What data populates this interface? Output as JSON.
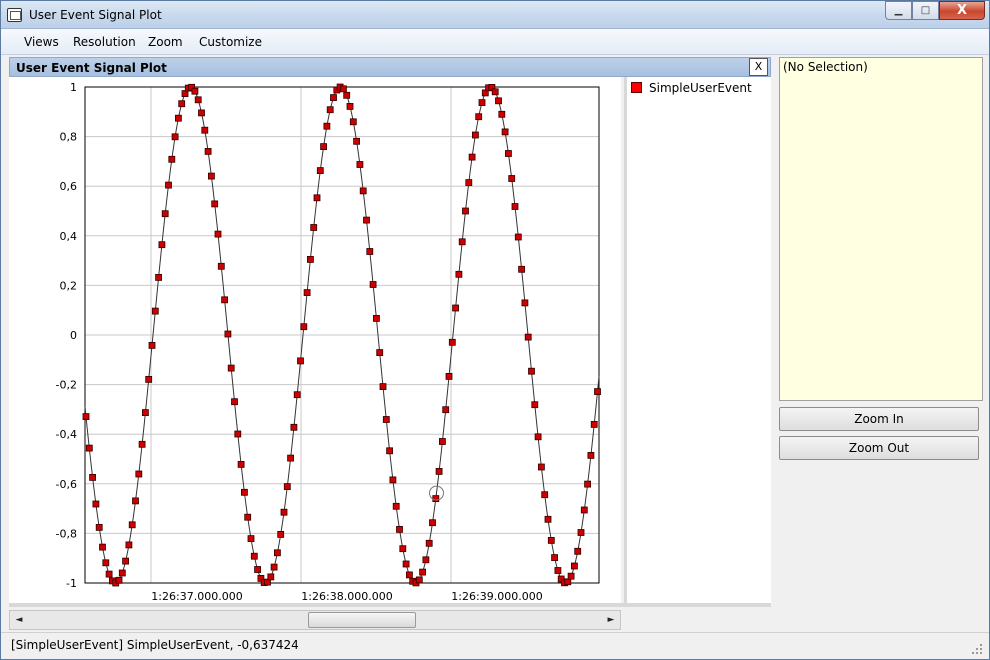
{
  "window": {
    "title": "User Event Signal Plot",
    "min_glyph": "▁",
    "max_glyph": "□",
    "close_glyph": "X"
  },
  "menu": {
    "items": [
      "Views",
      "Resolution",
      "Zoom",
      "Customize"
    ]
  },
  "panel": {
    "title": "User Event Signal Plot",
    "close_label": "X"
  },
  "legend": {
    "label": "SimpleUserEvent",
    "swatch_color": "#ff0000"
  },
  "info": {
    "text": "(No Selection)"
  },
  "buttons": {
    "zoom_in": "Zoom In",
    "zoom_out": "Zoom Out"
  },
  "status": {
    "text": "[SimpleUserEvent] SimpleUserEvent, -0,637424"
  },
  "scroll": {
    "left_arrow": "◄",
    "right_arrow": "►"
  },
  "chart_data": {
    "type": "scatter",
    "series": [
      {
        "name": "SimpleUserEvent",
        "color": "#cc0000",
        "function": "sine",
        "amplitude": 1,
        "period_s": 1
      }
    ],
    "x_ticks": [
      "1:26:37.000.000",
      "1:26:38.000.000",
      "1:26:39.000.000"
    ],
    "y_ticks": [
      "1",
      "0,8",
      "0,6",
      "0,4",
      "0,2",
      "0",
      "-0,2",
      "-0,4",
      "-0,6",
      "-0,8",
      "-1"
    ],
    "ylim": [
      -1,
      1
    ],
    "grid": true,
    "selected_point": {
      "value": -0.637424
    }
  }
}
